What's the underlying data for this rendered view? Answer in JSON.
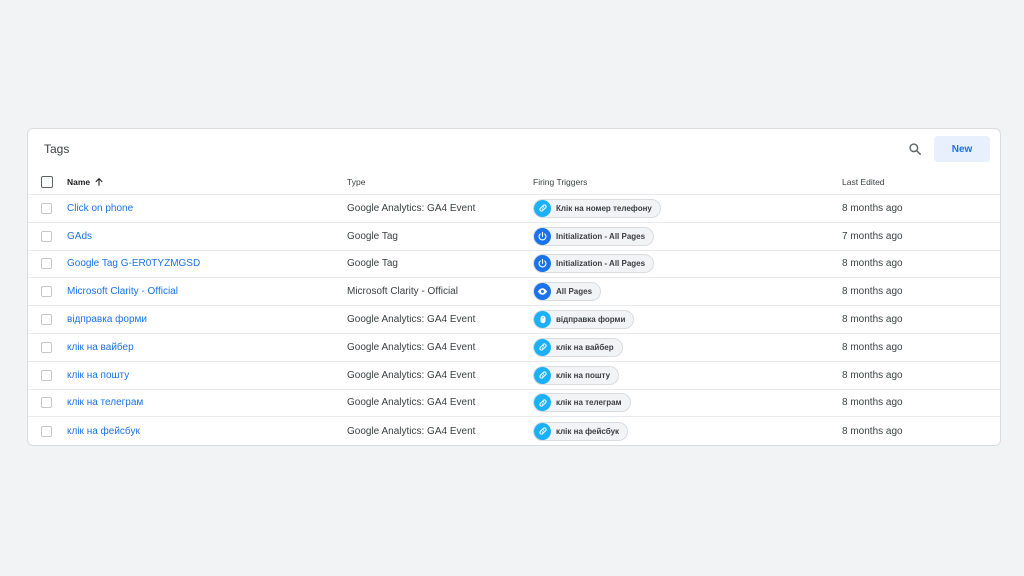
{
  "card": {
    "title": "Tags",
    "new_button": "New"
  },
  "columns": {
    "name": "Name",
    "type": "Type",
    "triggers": "Firing Triggers",
    "edited": "Last Edited"
  },
  "colors": {
    "link": "#1a73e8",
    "trigger_link": "#1cb0f6",
    "trigger_init": "#1a73e8",
    "trigger_pageview": "#1a73e8",
    "trigger_submit": "#1cb0f6"
  },
  "rows": [
    {
      "name": "Click on phone",
      "type": "Google Analytics: GA4 Event",
      "trigger": "Клік на номер телефону",
      "trigger_icon": "link-icon",
      "edited": "8 months ago"
    },
    {
      "name": "GAds",
      "type": "Google Tag",
      "trigger": "Initialization - All Pages",
      "trigger_icon": "power-icon",
      "edited": "7 months ago"
    },
    {
      "name": "Google Tag G-ER0TYZMGSD",
      "type": "Google Tag",
      "trigger": "Initialization - All Pages",
      "trigger_icon": "power-icon",
      "edited": "8 months ago"
    },
    {
      "name": "Microsoft Clarity - Official",
      "type": "Microsoft Clarity - Official",
      "trigger": "All Pages",
      "trigger_icon": "eye-icon",
      "edited": "8 months ago"
    },
    {
      "name": "відправка форми",
      "type": "Google Analytics: GA4 Event",
      "trigger": "відправка форми",
      "trigger_icon": "form-submit-icon",
      "edited": "8 months ago"
    },
    {
      "name": "клік на вайбер",
      "type": "Google Analytics: GA4 Event",
      "trigger": "клік на вайбер",
      "trigger_icon": "link-icon",
      "edited": "8 months ago"
    },
    {
      "name": "клік на пошту",
      "type": "Google Analytics: GA4 Event",
      "trigger": "клік на пошту",
      "trigger_icon": "link-icon",
      "edited": "8 months ago"
    },
    {
      "name": "клік на телеграм",
      "type": "Google Analytics: GA4 Event",
      "trigger": "клік на телеграм",
      "trigger_icon": "link-icon",
      "edited": "8 months ago"
    },
    {
      "name": "клік на фейсбук",
      "type": "Google Analytics: GA4 Event",
      "trigger": "клік на фейсбук",
      "trigger_icon": "link-icon",
      "edited": "8 months ago"
    }
  ]
}
